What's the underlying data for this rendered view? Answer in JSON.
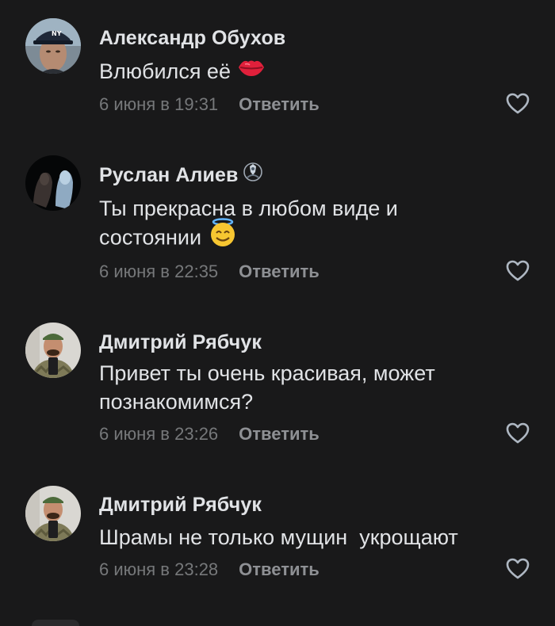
{
  "comments": [
    {
      "author": "Александр Обухов",
      "text_line1": "Влюбился её",
      "text_line2": "",
      "date": "6 июня в 19:31",
      "reply": "Ответить",
      "emoji": "lips-emoji"
    },
    {
      "author": "Руслан Алиев",
      "text_line1": "Ты прекрасна в любом виде и",
      "text_line2": "состоянии",
      "date": "6 июня в 22:35",
      "reply": "Ответить",
      "emoji": "smiling-face-with-halo-emoji",
      "badge": "donut-badge-icon"
    },
    {
      "author": "Дмитрий Рябчук",
      "text_line1": "Привет ты очень красивая, может",
      "text_line2": "познакомимся?",
      "date": "6 июня в 23:26",
      "reply": "Ответить"
    },
    {
      "author": "Дмитрий Рябчук",
      "text_line1": "Шрамы не только мущин  укрощают",
      "text_line2": "",
      "date": "6 июня в 23:28",
      "reply": "Ответить"
    }
  ],
  "colors": {
    "background": "#19191a",
    "primary_text": "#e1e3e6",
    "secondary_text": "#76787a"
  }
}
